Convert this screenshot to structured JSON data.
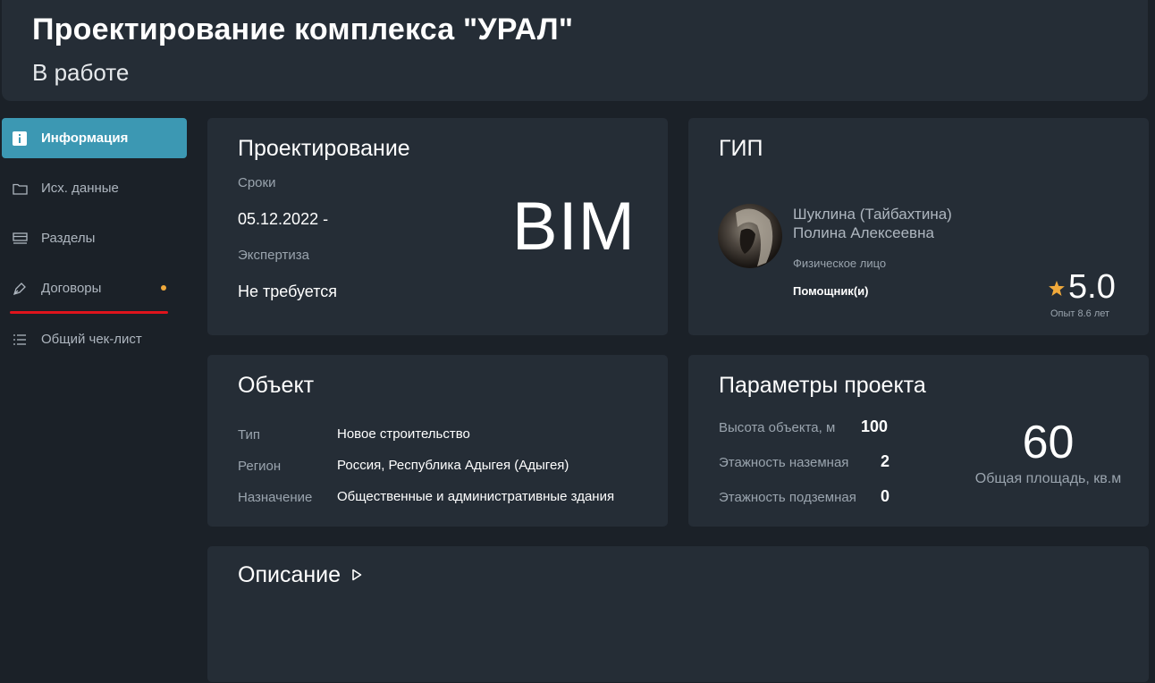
{
  "header": {
    "title": "Проектирование комплекса \"УРАЛ\"",
    "status": "В работе"
  },
  "sidebar": {
    "items": [
      {
        "label": "Информация",
        "icon": "info-icon",
        "active": true
      },
      {
        "label": "Исх. данные",
        "icon": "folder-icon"
      },
      {
        "label": "Разделы",
        "icon": "sections-icon"
      },
      {
        "label": "Договоры",
        "icon": "pen-icon",
        "has_notification": true
      },
      {
        "label": "Общий чек-лист",
        "icon": "checklist-icon"
      }
    ]
  },
  "design": {
    "title": "Проектирование",
    "deadlines_label": "Сроки",
    "deadlines_value": "05.12.2022 -",
    "expertise_label": "Экспертиза",
    "expertise_value": "Не требуется",
    "badge": "BIM"
  },
  "gip": {
    "title": "ГИП",
    "name_line1": "Шуклина (Тайбахтина)",
    "name_line2": "Полина Алексеевна",
    "person_type": "Физическое лицо",
    "role": "Помощник(и)",
    "rating": "5.0",
    "experience": "Опыт 8.6 лет"
  },
  "object": {
    "title": "Объект",
    "rows": [
      {
        "label": "Тип",
        "value": "Новое строительство"
      },
      {
        "label": "Регион",
        "value": "Россия, Республика Адыгея (Адыгея)"
      },
      {
        "label": "Назначение",
        "value": "Общественные и административные здания"
      }
    ]
  },
  "params": {
    "title": "Параметры проекта",
    "rows": [
      {
        "label": "Высота объекта, м",
        "value": "100"
      },
      {
        "label": "Этажность наземная",
        "value": "2"
      },
      {
        "label": "Этажность подземная",
        "value": "0"
      }
    ],
    "area_value": "60",
    "area_label": "Общая площадь, кв.м"
  },
  "description": {
    "title": "Описание"
  },
  "colors": {
    "background": "#1b2128",
    "card": "#252d36",
    "accent": "#3c98b3",
    "notification_dot": "#f0a93b",
    "star": "#f0a93b",
    "underline": "#e0141c"
  }
}
